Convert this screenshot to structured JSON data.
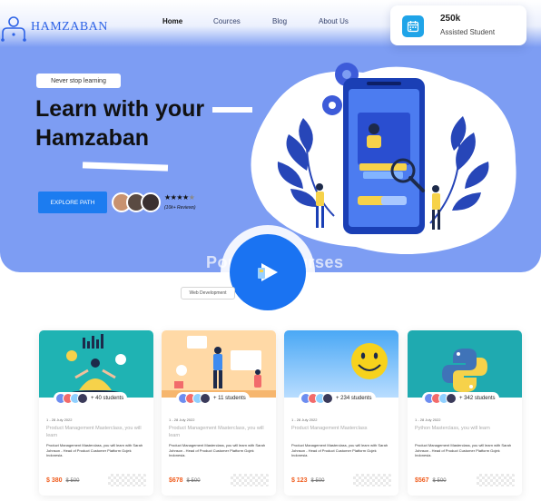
{
  "brand": {
    "name": "HAMZABAN"
  },
  "nav": {
    "items": [
      "Home",
      "Cources",
      "Blog",
      "About Us"
    ]
  },
  "stat": {
    "value": "250k",
    "label": "Assisted Student",
    "icon": "calendar-icon"
  },
  "hero": {
    "tagline": "Never stop learning",
    "headline_line1": "Learn with your",
    "headline_line2": "Hamzaban",
    "cta_label": "EXPLORE PATH",
    "rating_stars": "★★★★",
    "rating_half": "★",
    "reviews": "(10k+ Reviews)",
    "rating": 4.5
  },
  "section": {
    "title": "Popular Courses",
    "filter_chip": "Web Development"
  },
  "colors": {
    "hero_bg": "#7d9df3",
    "accent": "#1c7cf0",
    "price": "#f05c1d"
  },
  "courses": [
    {
      "students": "+ 40 students",
      "date": "1 - 28 July 2022",
      "title": "Product Management Masterclass, you will learn",
      "desc": "Product Management Masterclass, you will learn with Sarah Johnson - Head of Product Customer Platform Gojek Indonesia.",
      "price": "$ 380",
      "old_price": "$ 500"
    },
    {
      "students": "+ 11 students",
      "date": "1 - 28 July 2022",
      "title": "Product Management Masterclass, you will learn",
      "desc": "Product Management Masterclass, you will learn with Sarah Johnson - Head of Product Customer Platform Gojek Indonesia.",
      "price": "$678",
      "old_price": "$ 500"
    },
    {
      "students": "+ 234 students",
      "date": "1 - 28 July 2022",
      "title": "Product Management Masterclass",
      "desc": "Product Management Masterclass, you will learn with Sarah Johnson - Head of Product Customer Platform Gojek Indonesia.",
      "price": "$ 123",
      "old_price": "$ 500"
    },
    {
      "students": "+ 342 students",
      "date": "1 - 28 July 2022",
      "title": "Python Masterclass, you will learn",
      "desc": "Product Management Masterclass, you will learn with Sarah Johnson - Head of Product Customer Platform Gojek Indonesia.",
      "price": "$567",
      "old_price": "$ 500"
    }
  ]
}
